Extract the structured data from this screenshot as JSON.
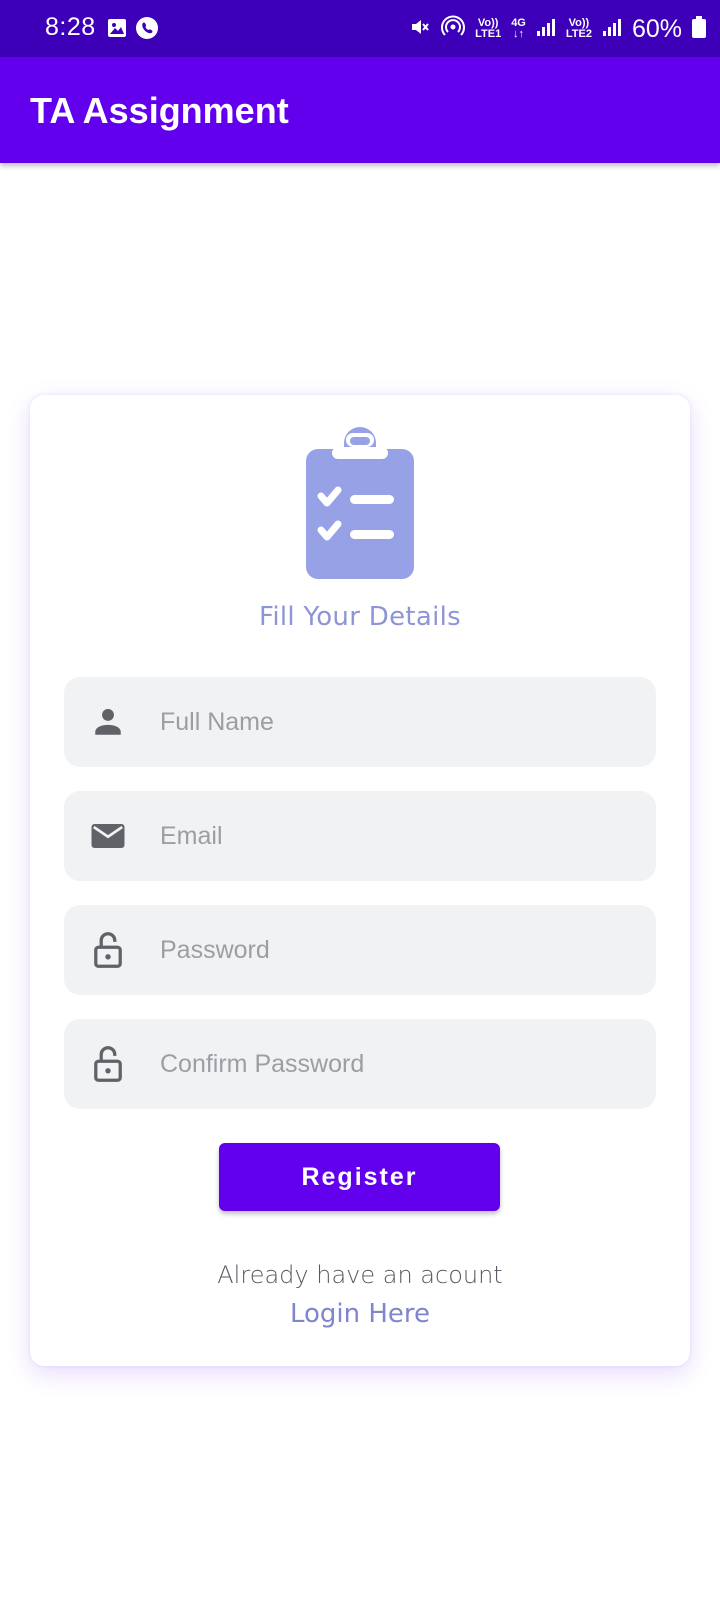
{
  "status_bar": {
    "time": "8:28",
    "lte1_top": "Vo))",
    "lte1_bottom": "LTE1",
    "network_type": "4G",
    "lte2_top": "Vo))",
    "lte2_bottom": "LTE2",
    "battery": "60%"
  },
  "app_bar": {
    "title": "TA Assignment"
  },
  "form": {
    "heading": "Fill Your Details",
    "fields": {
      "full_name": {
        "placeholder": "Full Name",
        "icon": "person-icon"
      },
      "email": {
        "placeholder": "Email",
        "icon": "mail-icon"
      },
      "password": {
        "placeholder": "Password",
        "icon": "lock-open-icon"
      },
      "confirm_password": {
        "placeholder": "Confirm Password",
        "icon": "lock-open-icon"
      }
    },
    "register_label": "Register",
    "already_text": "Already have an acount",
    "login_label": "Login Here"
  },
  "colors": {
    "status_bar": "#3d00b8",
    "primary": "#6200ee",
    "clipboard": "#97a1e5",
    "link": "#7f86c9",
    "field_bg": "#f1f2f4"
  }
}
